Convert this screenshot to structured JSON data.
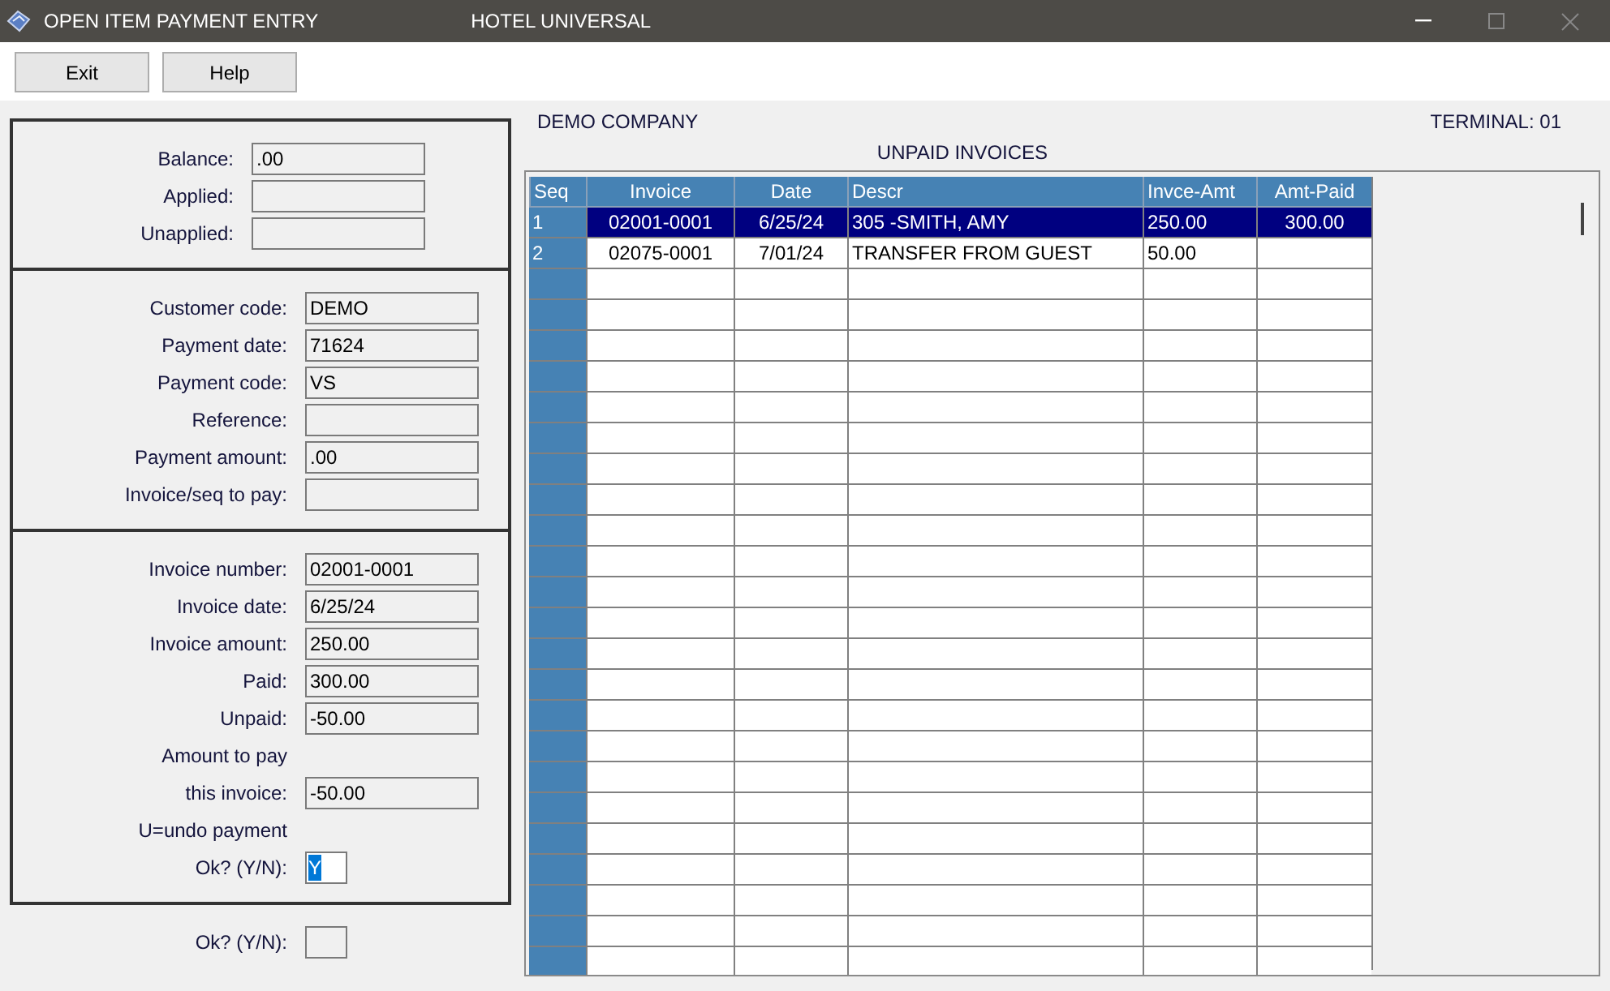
{
  "window": {
    "title": "OPEN ITEM PAYMENT ENTRY",
    "subtitle": "HOTEL UNIVERSAL"
  },
  "toolbar": {
    "buttons": [
      "Exit",
      "Help"
    ]
  },
  "sections": [
    {
      "rows": [
        {
          "kind": "field",
          "label": "Balance:",
          "value": ".00"
        },
        {
          "kind": "field",
          "label": "Applied:"
        },
        {
          "kind": "field",
          "label": "Unapplied:"
        }
      ]
    },
    {
      "rows": [
        {
          "kind": "field",
          "label": "Customer code:",
          "value": "DEMO"
        },
        {
          "kind": "field",
          "label": "Payment date:",
          "value": "71624"
        },
        {
          "kind": "field",
          "label": "Payment code:",
          "value": "VS"
        },
        {
          "kind": "field",
          "label": "Reference:"
        },
        {
          "kind": "field",
          "label": "Payment amount:",
          "value": ".00"
        },
        {
          "kind": "field",
          "label": "Invoice/seq to pay:"
        }
      ]
    },
    {
      "rows": [
        {
          "kind": "field",
          "label": "Invoice number:",
          "value": "02001-0001"
        },
        {
          "kind": "field",
          "label": "Invoice date:",
          "value": "6/25/24"
        },
        {
          "kind": "field",
          "label": "Invoice amount:",
          "value": "250.00"
        },
        {
          "kind": "field",
          "label": "Paid:",
          "value": "300.00"
        },
        {
          "kind": "field",
          "label": "Unpaid:",
          "value": "-50.00"
        },
        {
          "kind": "text",
          "label": "Amount to pay"
        },
        {
          "kind": "field",
          "label": "this invoice:",
          "value": "-50.00"
        },
        {
          "kind": "text",
          "label": "U=undo payment"
        },
        {
          "kind": "confirm",
          "label": "Ok? (Y/N):",
          "value": "Y",
          "selected": true
        }
      ]
    }
  ],
  "final_prompt": {
    "kind": "confirm",
    "label": "Ok? (Y/N):"
  },
  "company": "DEMO COMPANY",
  "terminal": "TERMINAL: 01",
  "table": {
    "title": "UNPAID INVOICES",
    "columns": [
      "Seq",
      "Invoice",
      "Date",
      "Descr",
      "Invce-Amt",
      "Amt-Paid"
    ],
    "rows": [
      {
        "selected": true,
        "cells": [
          "1",
          "02001-0001",
          "6/25/24",
          "305 -SMITH, AMY",
          "250.00",
          "300.00"
        ]
      },
      {
        "selected": false,
        "cells": [
          "2",
          "02075-0001",
          "7/01/24",
          "TRANSFER FROM GUEST",
          "50.00",
          ""
        ]
      }
    ]
  }
}
